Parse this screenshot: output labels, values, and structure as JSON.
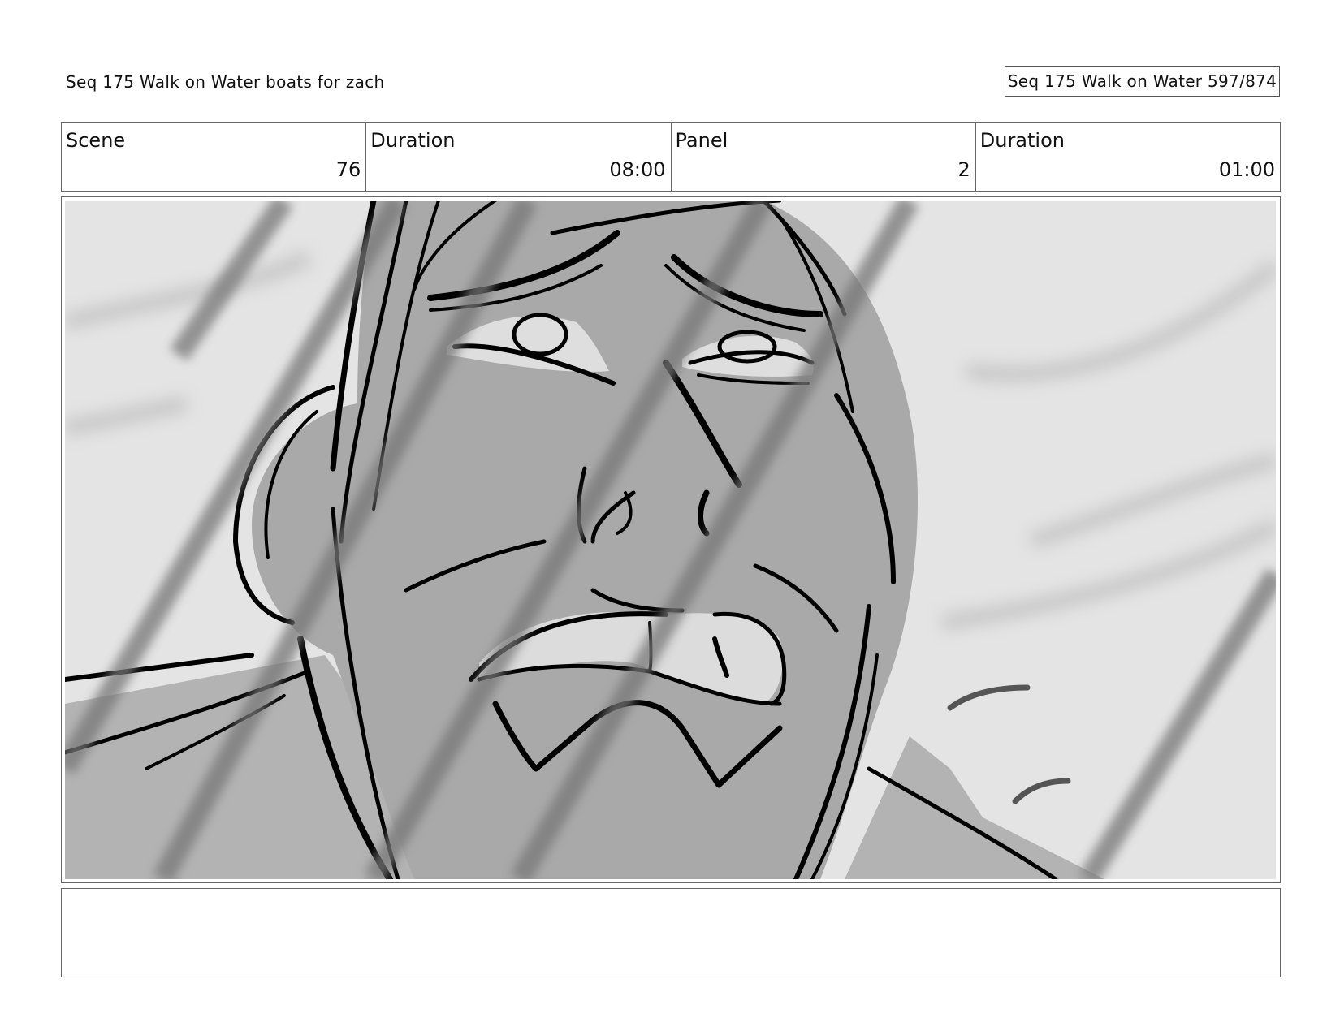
{
  "header": {
    "title": "Seq 175 Walk on Water  boats for zach",
    "page_label": "Seq 175 Walk on Water 597/874"
  },
  "info": {
    "scene_label": "Scene",
    "scene_value": "76",
    "scene_duration_label": "Duration",
    "scene_duration_value": "08:00",
    "panel_label": "Panel",
    "panel_value": "2",
    "panel_duration_label": "Duration",
    "panel_duration_value": "01:00"
  },
  "panel": {
    "image_subject": "storyboard-sketch-face-closeup",
    "palette": {
      "background": "#e4e4e4",
      "skin": "#a9a9a9",
      "ink": "#000000",
      "streak": "#777777"
    }
  },
  "notes": {
    "text": ""
  }
}
